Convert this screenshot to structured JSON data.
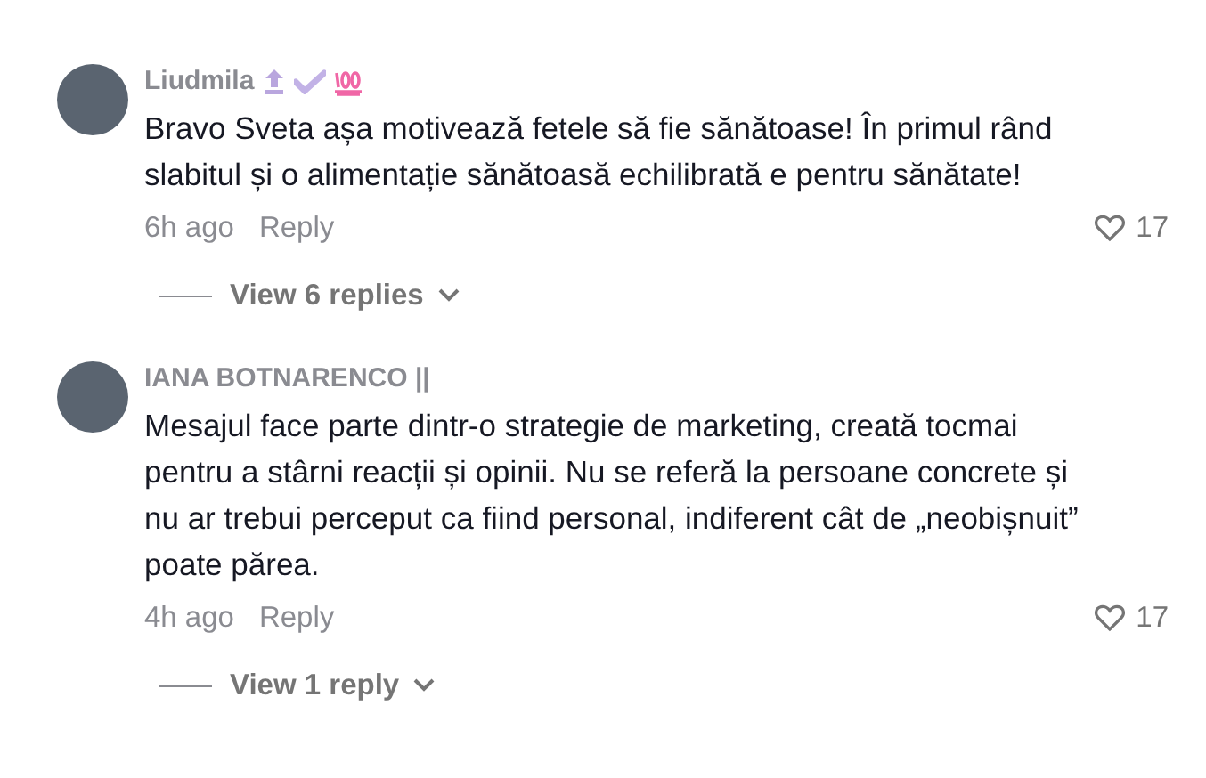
{
  "comments": [
    {
      "author": "Liudmila",
      "badges": [
        {
          "kind": "top"
        },
        {
          "kind": "verified"
        },
        {
          "kind": "hundred"
        }
      ],
      "text": "Bravo Sveta așa motivează fetele să fie sănătoase! În primul rând slabitul și o alimentație sănătoasă echilibrată e pentru sănătate!",
      "time": "6h ago",
      "reply": "Reply",
      "likes": "17",
      "view_replies": "View 6 replies"
    },
    {
      "author": "IANA BOTNARENCO ||",
      "text": "Mesajul face parte dintr-o strategie de marketing, creată tocmai pentru a stârni reacții și opinii. Nu se referă la persoane concrete și nu ar trebui perceput ca fiind personal, indiferent cât de „neobișnuit” poate părea.",
      "time": "4h ago",
      "reply": "Reply",
      "likes": "17",
      "view_replies": "View 1 reply"
    }
  ]
}
